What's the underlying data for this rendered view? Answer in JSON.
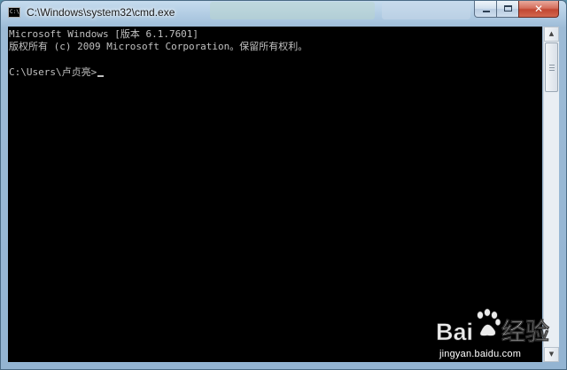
{
  "window": {
    "title": "C:\\Windows\\system32\\cmd.exe",
    "app_icon_text": "C:\\",
    "background_tabs": [
      {
        "label": ""
      },
      {
        "label": ""
      }
    ],
    "controls": {
      "minimize_icon": "minimize-icon",
      "maximize_icon": "maximize-icon",
      "close_glyph": "✕"
    }
  },
  "console": {
    "lines": [
      "Microsoft Windows [版本 6.1.7601]",
      "版权所有 (c) 2009 Microsoft Corporation。保留所有权利。",
      "C:\\Users\\卢贞亮>"
    ],
    "colors": {
      "background": "#000000",
      "foreground": "#c0c0c0"
    }
  },
  "scrollbar": {
    "up_arrow": "▲",
    "down_arrow": "▼"
  },
  "watermark": {
    "logo_text": "Bai 经验",
    "url": "jingyan.baidu.com"
  }
}
